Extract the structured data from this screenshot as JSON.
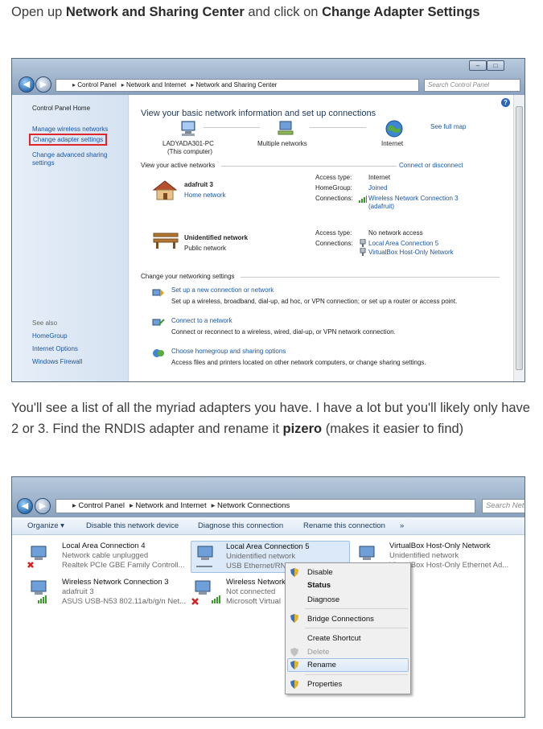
{
  "para1": {
    "t1": "Open up ",
    "b1": "Network and Sharing Center",
    "t2": " and click on ",
    "b2": "Change Adapter Settings"
  },
  "para2": {
    "t1": "You'll see a list of all the myriad adapters you have. I have a lot but you'll likely only have 2 or 3. Find the RNDIS adapter and rename it ",
    "b1": "pizero",
    "t2": " (makes it easier to find)"
  },
  "shot1": {
    "breadcrumb": [
      "Control Panel",
      "Network and Internet",
      "Network and Sharing Center"
    ],
    "search_placeholder": "Search Control Panel",
    "sidebar": {
      "home": "Control Panel Home",
      "items": [
        "Manage wireless networks",
        "Change adapter settings",
        "Change advanced sharing settings"
      ],
      "see_also": "See also",
      "see_also_items": [
        "HomeGroup",
        "Internet Options",
        "Windows Firewall"
      ]
    },
    "main": {
      "title": "View your basic network information and set up connections",
      "see_full_map": "See full map",
      "map": {
        "computer": "LADYADA301-PC",
        "computer_sub": "(This computer)",
        "middle": "Multiple networks",
        "internet": "Internet"
      },
      "active_label": "View your active networks",
      "connect_disconnect": "Connect or disconnect",
      "net1": {
        "name": "adafruit  3",
        "type": "Home network",
        "access_label": "Access type:",
        "access": "Internet",
        "homegroup_label": "HomeGroup:",
        "homegroup": "Joined",
        "conn_label": "Connections:",
        "conn": "Wireless Network Connection 3",
        "conn_sub": "(adafruit)"
      },
      "net2": {
        "name": "Unidentified network",
        "type": "Public network",
        "access_label": "Access type:",
        "access": "No network access",
        "conn_label": "Connections:",
        "conn1": "Local Area Connection 5",
        "conn2": "VirtualBox Host-Only Network"
      },
      "change_label": "Change your networking settings",
      "tasks": [
        {
          "link": "Set up a new connection or network",
          "desc": "Set up a wireless, broadband, dial-up, ad hoc, or VPN connection; or set up a router or access point."
        },
        {
          "link": "Connect to a network",
          "desc": "Connect or reconnect to a wireless, wired, dial-up, or VPN network connection."
        },
        {
          "link": "Choose homegroup and sharing options",
          "desc": "Access files and printers located on other network computers, or change sharing settings."
        }
      ]
    }
  },
  "shot2": {
    "breadcrumb": [
      "Control Panel",
      "Network and Internet",
      "Network Connections"
    ],
    "search_placeholder": "Search Net",
    "toolbar": [
      "Organize ▾",
      "Disable this network device",
      "Diagnose this connection",
      "Rename this connection",
      "»"
    ],
    "adapters": [
      {
        "name": "Local Area Connection 4",
        "status": "Network cable unplugged",
        "device": "Realtek PCIe GBE Family Controll..."
      },
      {
        "name": "Local Area Connection 5",
        "status": "Unidentified network",
        "device": "USB Ethernet/RNDI"
      },
      {
        "name": "VirtualBox Host-Only Network",
        "status": "Unidentified network",
        "device": "VirtualBox Host-Only Ethernet Ad..."
      },
      {
        "name": "Wireless Network Connection 3",
        "status": "adafruit  3",
        "device": "ASUS USB-N53 802.11a/b/g/n Net..."
      },
      {
        "name": "Wireless Network",
        "status": "Not connected",
        "device": "Microsoft Virtual"
      }
    ],
    "context_menu": [
      "Disable",
      "Status",
      "Diagnose",
      "Bridge Connections",
      "Create Shortcut",
      "Delete",
      "Rename",
      "Properties"
    ]
  },
  "colors": {
    "link": "#1a56a8",
    "highlight_box": "#e0262d",
    "heading": "#1e395b"
  }
}
